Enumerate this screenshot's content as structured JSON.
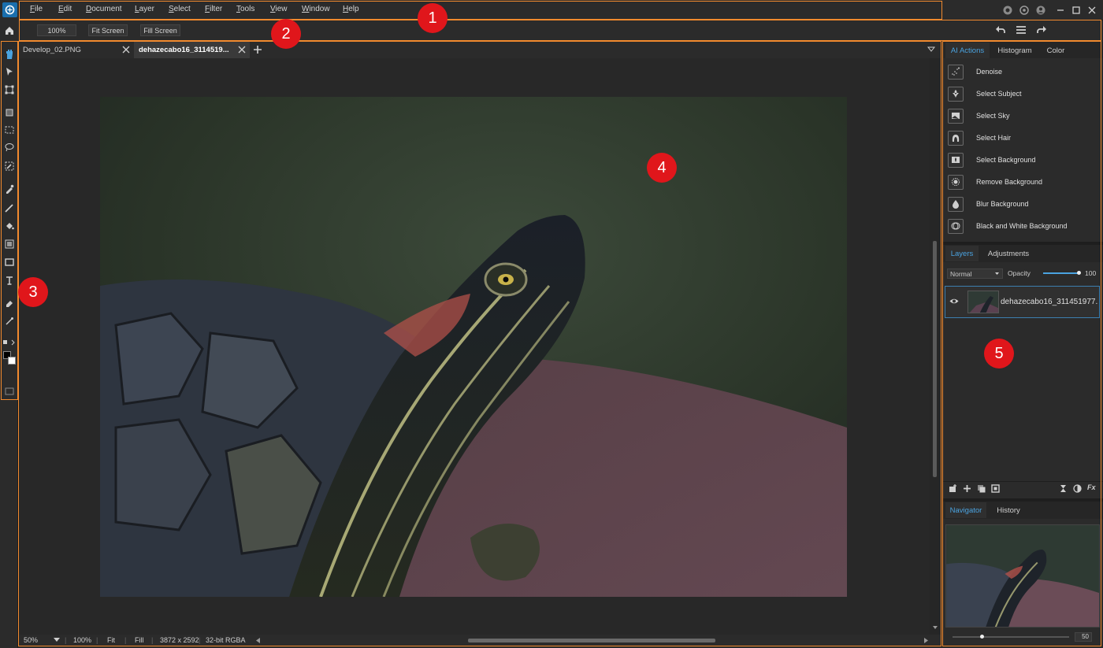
{
  "menu": {
    "items": [
      "File",
      "Edit",
      "Document",
      "Layer",
      "Select",
      "Filter",
      "Tools",
      "View",
      "Window",
      "Help"
    ]
  },
  "toolbar": {
    "zoom_value": "100%",
    "fit_screen": "Fit Screen",
    "fill_screen": "Fill Screen"
  },
  "tabs": [
    {
      "label": "Develop_02.PNG",
      "active": false
    },
    {
      "label": "dehazecabo16_3114519...",
      "active": true
    }
  ],
  "panels": {
    "top_tabs": [
      "AI Actions",
      "Histogram",
      "Color"
    ],
    "ai_actions": [
      "Denoise",
      "Select Subject",
      "Select Sky",
      "Select Hair",
      "Select Background",
      "Remove Background",
      "Blur Background",
      "Black and White Background"
    ],
    "layer_tabs": [
      "Layers",
      "Adjustments"
    ],
    "blend_mode": "Normal",
    "opacity_label": "Opacity",
    "opacity_value": "100",
    "opacity_fraction": 1.0,
    "layer_name": "dehazecabo16_311451977...",
    "nav_tabs": [
      "Navigator",
      "History"
    ],
    "nav_zoom": "50",
    "nav_zoom_fraction": 0.25
  },
  "status": {
    "zoom": "50%",
    "zoom100": "100%",
    "fit": "Fit",
    "fill": "Fill",
    "dimensions": "3872 x 2592",
    "mode": "32-bit RGBA"
  },
  "annotations": [
    "1",
    "2",
    "3",
    "4",
    "5"
  ],
  "colors": {
    "accent": "#4aa3e0",
    "marker": "#e0161b",
    "highlight_border": "#f28a2e"
  }
}
